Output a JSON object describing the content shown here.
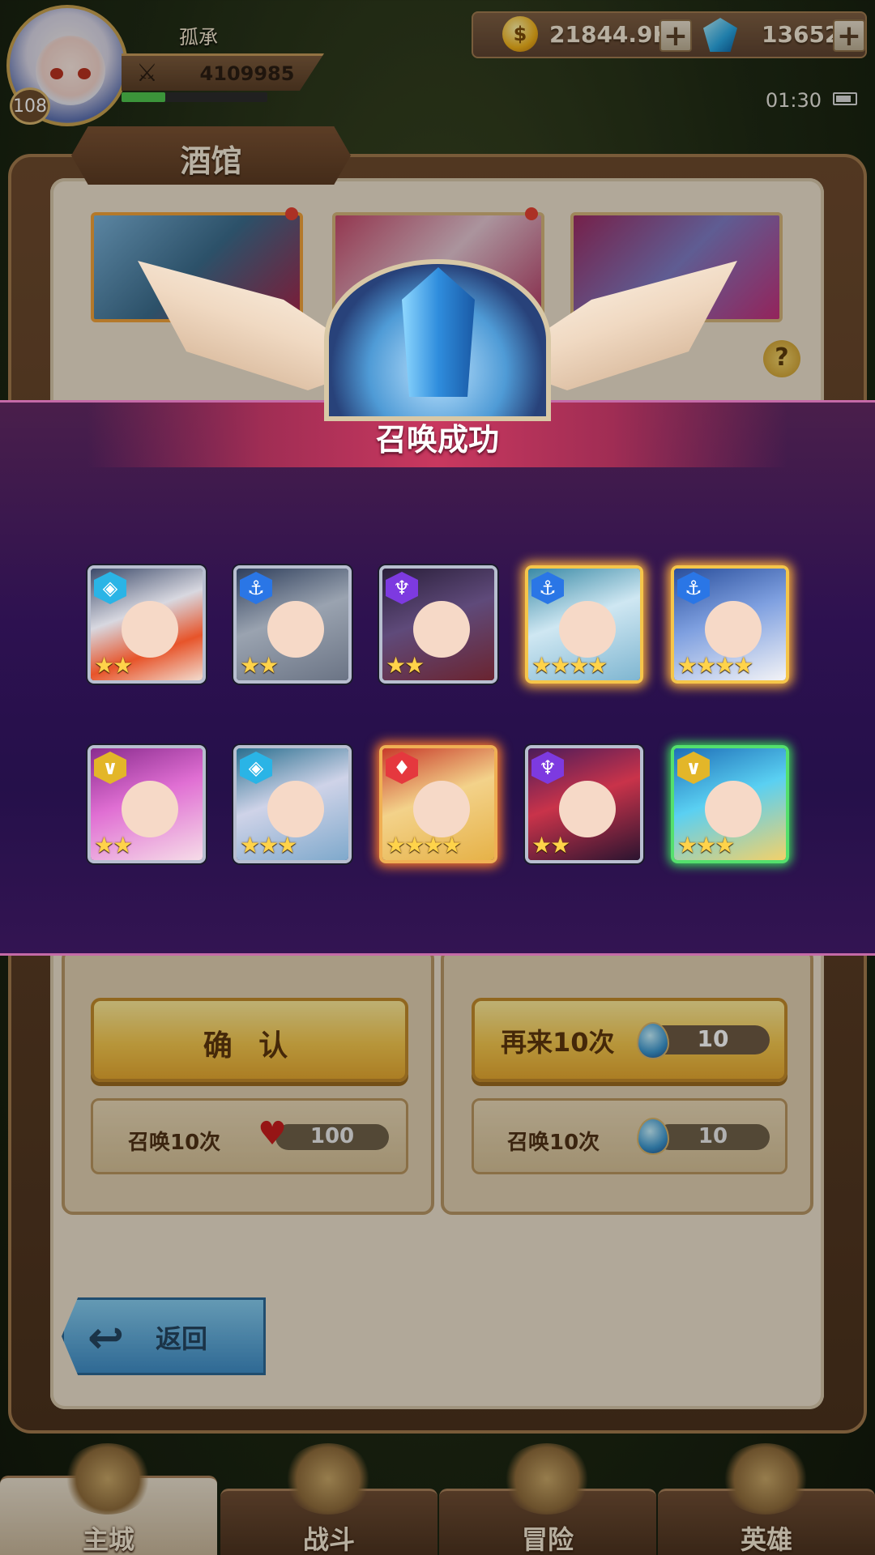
{
  "player": {
    "name": "孤承",
    "power": "4109985",
    "level": "108",
    "exp_fraction": 0.3
  },
  "currency": {
    "gold": "21844.9K",
    "gold_plus": "+",
    "gems": "13652",
    "gems_plus": "+"
  },
  "status": {
    "time": "01:30"
  },
  "tavern": {
    "title": "酒馆",
    "help": "?",
    "confirm_label": "确 认",
    "again_label": "再来10次",
    "again_cost": "10",
    "summon_left_label": "召唤10次",
    "summon_left_cost": "100",
    "summon_right_label": "召唤10次",
    "summon_right_cost": "10",
    "back_label": "返回"
  },
  "result": {
    "title": "召唤成功",
    "heroes": [
      {
        "stars": 2,
        "class_icon": "cyan-diamond-icon"
      },
      {
        "stars": 2,
        "class_icon": "blue-anchor-icon"
      },
      {
        "stars": 2,
        "class_icon": "purple-horn-icon"
      },
      {
        "stars": 4,
        "class_icon": "blue-anchor-icon"
      },
      {
        "stars": 4,
        "class_icon": "blue-anchor-icon"
      },
      {
        "stars": 2,
        "class_icon": "yellow-chevron-icon"
      },
      {
        "stars": 3,
        "class_icon": "cyan-diamond-icon"
      },
      {
        "stars": 4,
        "class_icon": "red-flame-icon"
      },
      {
        "stars": 2,
        "class_icon": "purple-horn-icon"
      },
      {
        "stars": 3,
        "class_icon": "yellow-chevron-icon"
      }
    ]
  },
  "nav": {
    "tabs": [
      "主城",
      "战斗",
      "冒险",
      "英雄"
    ],
    "active": "主城"
  },
  "colors": {
    "panel_bg": "#ece1cd",
    "overlay_band": "#2d1150",
    "gold_button": "#f5c84e",
    "back_button": "#3f8dc6"
  }
}
